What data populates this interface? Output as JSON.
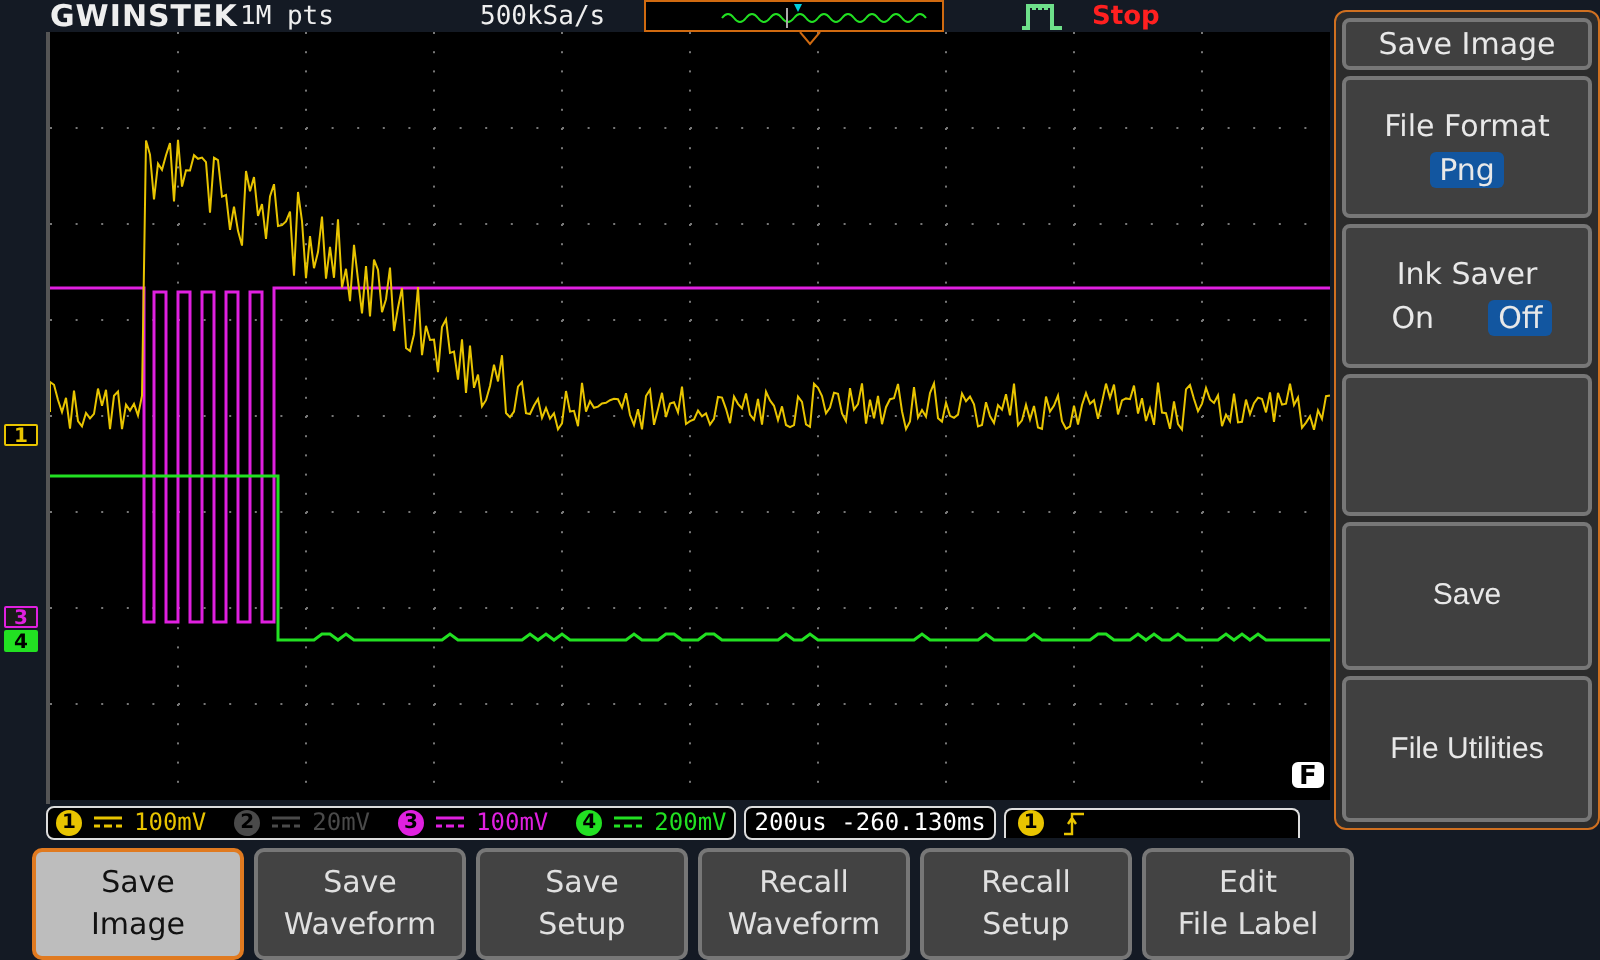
{
  "header": {
    "brand": "GWINSTEK",
    "memory": "1M pts",
    "sample_rate": "500kSa/s",
    "run_state": "Stop"
  },
  "channel_markers": [
    {
      "label": "1",
      "color": "#e8c400"
    },
    {
      "label": "3",
      "color": "#e020e0"
    },
    {
      "label": "4",
      "color": "#22e022"
    }
  ],
  "function_marker": "F",
  "channels": [
    {
      "number": "1",
      "scale": "100mV",
      "on": true,
      "color": "#e8c400"
    },
    {
      "number": "2",
      "scale": "20mV",
      "on": false,
      "color": "#4a4a4a"
    },
    {
      "number": "3",
      "scale": "100mV",
      "on": true,
      "color": "#e020e0"
    },
    {
      "number": "4",
      "scale": "200mV",
      "on": true,
      "color": "#22e022"
    }
  ],
  "timebase": {
    "scale": "200us",
    "position": "-260.130ms"
  },
  "trigger": {
    "source": "1"
  },
  "side_menu": {
    "title": "Save Image",
    "items": [
      {
        "kind": "option",
        "label": "File Format",
        "options": [
          {
            "label": "Png",
            "selected": true
          }
        ]
      },
      {
        "kind": "toggle",
        "label": "Ink Saver",
        "options": [
          {
            "label": "On",
            "selected": false
          },
          {
            "label": "Off",
            "selected": true
          }
        ]
      },
      {
        "kind": "blank"
      },
      {
        "kind": "action",
        "label": "Save"
      },
      {
        "kind": "action",
        "label": "File Utilities"
      }
    ]
  },
  "softkeys": [
    {
      "label": "Save\nImage",
      "selected": true
    },
    {
      "label": "Save\nWaveform",
      "selected": false
    },
    {
      "label": "Save\nSetup",
      "selected": false
    },
    {
      "label": "Recall\nWaveform",
      "selected": false
    },
    {
      "label": "Recall\nSetup",
      "selected": false
    },
    {
      "label": "Edit\nFile Label",
      "selected": false
    }
  ]
}
